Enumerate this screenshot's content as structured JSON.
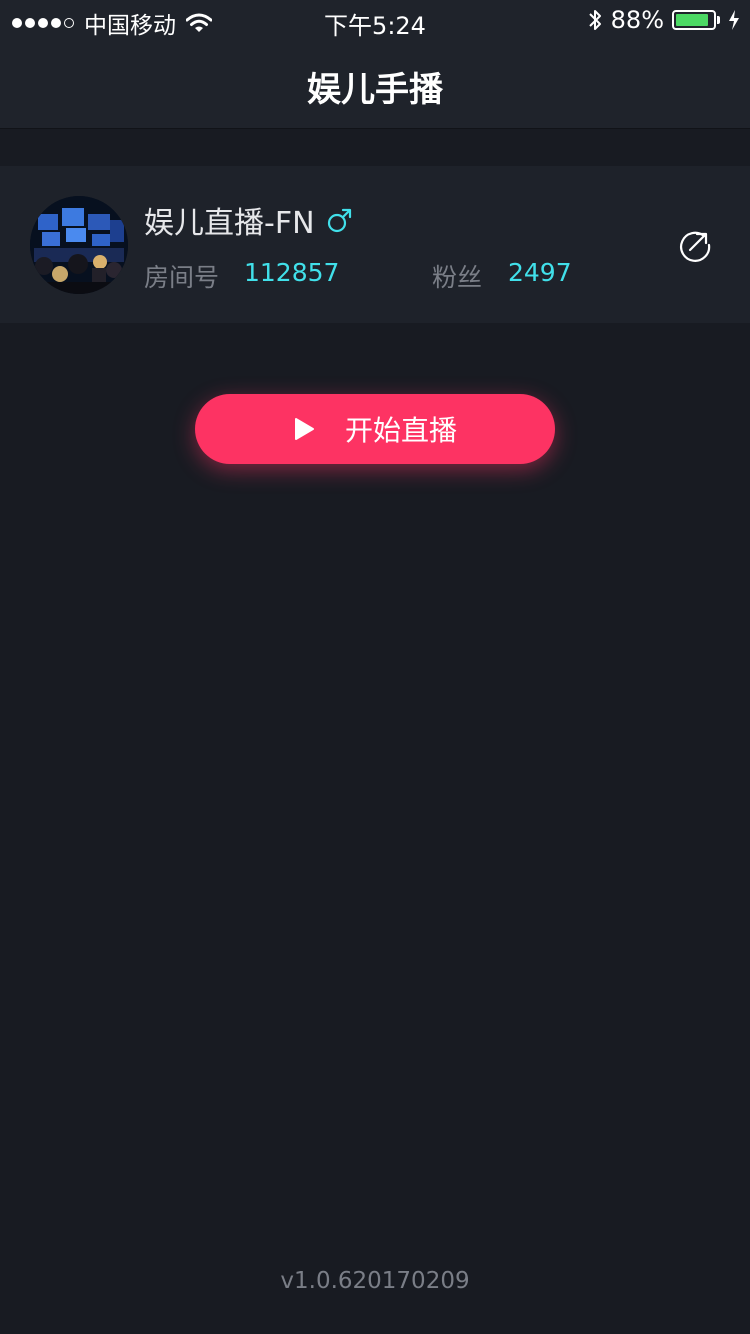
{
  "status_bar": {
    "signal_bars_filled": 4,
    "signal_bars_total": 5,
    "carrier": "中国移动",
    "time": "下午5:24",
    "battery_percent_label": "88%",
    "battery_level": 0.88,
    "icons": [
      "wifi-icon",
      "bluetooth-icon",
      "battery-icon",
      "charging-bolt-icon"
    ]
  },
  "nav": {
    "title": "娱儿手播"
  },
  "profile": {
    "name": "娱儿直播-FN",
    "gender_icon": "male-symbol-icon",
    "room_label": "房间号",
    "room_number": "112857",
    "fans_label": "粉丝",
    "fans_count": "2497",
    "action_icon": "share-arrow-icon"
  },
  "start_button": {
    "label": "开始直播",
    "icon": "play-icon"
  },
  "footer": {
    "version": "v1.0.620170209"
  },
  "colors": {
    "background": "#181b22",
    "header": "#1f232b",
    "card": "#1e222a",
    "accent_pink": "#fd3363",
    "accent_cyan": "#41e0ea",
    "muted_text": "#7a7e87"
  }
}
